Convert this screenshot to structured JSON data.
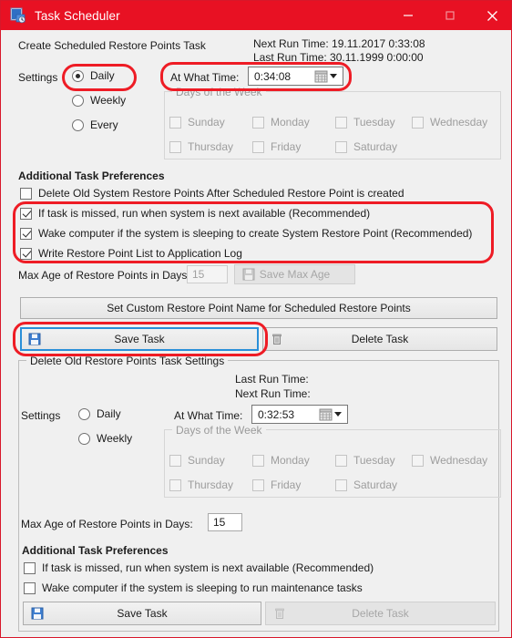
{
  "window": {
    "title": "Task Scheduler",
    "icon": "task-scheduler-icon",
    "minimize": "–",
    "maximize": "□",
    "close": "✕",
    "accent_color": "#e81123",
    "client_bg": "#f0f0f0"
  },
  "top": {
    "heading": "Create Scheduled Restore Points Task",
    "next_run_time": "Next Run Time: 19.11.2017 0:33:08",
    "last_run_time": "Last Run Time: 30.11.1999 0:00:00",
    "settings_label": "Settings",
    "radios": [
      {
        "label": "Daily",
        "checked": true
      },
      {
        "label": "Weekly",
        "checked": false
      },
      {
        "label": "Every",
        "checked": false
      }
    ],
    "time_label": "At What Time:",
    "time_value": "0:34:08",
    "days_group_legend": "Days of the Week",
    "days": [
      {
        "label": "Sunday",
        "checked": false
      },
      {
        "label": "Monday",
        "checked": false
      },
      {
        "label": "Tuesday",
        "checked": false
      },
      {
        "label": "Wednesday",
        "checked": false
      },
      {
        "label": "Thursday",
        "checked": false
      },
      {
        "label": "Friday",
        "checked": false
      },
      {
        "label": "Saturday",
        "checked": false
      }
    ]
  },
  "prefs": {
    "heading": "Additional Task Preferences",
    "items": [
      {
        "label": "Delete Old System Restore Points After Scheduled Restore Point is created",
        "checked": false
      },
      {
        "label": "If task is missed, run when system is next available (Recommended)",
        "checked": true
      },
      {
        "label": "Wake computer if the system is sleeping to create System Restore Point (Recommended)",
        "checked": true
      },
      {
        "label": "Write Restore Point List to Application Log",
        "checked": true
      }
    ],
    "max_age_label": "Max Age of Restore Points in Days:",
    "max_age_value": "15",
    "save_max_age_label": "Save Max Age",
    "custom_name_button": "Set Custom Restore Point Name for Scheduled Restore Points",
    "save_task_label": "Save Task",
    "delete_task_label": "Delete Task"
  },
  "bottom": {
    "group_legend": "Delete Old Restore Points Task Settings",
    "last_run_time": "Last Run Time:",
    "next_run_time": "Next Run Time:",
    "settings_label": "Settings",
    "radios": [
      {
        "label": "Daily",
        "checked": false
      },
      {
        "label": "Weekly",
        "checked": false
      }
    ],
    "time_label": "At What Time:",
    "time_value": "0:32:53",
    "days_group_legend": "Days of the Week",
    "days": [
      {
        "label": "Sunday",
        "checked": false
      },
      {
        "label": "Monday",
        "checked": false
      },
      {
        "label": "Tuesday",
        "checked": false
      },
      {
        "label": "Wednesday",
        "checked": false
      },
      {
        "label": "Thursday",
        "checked": false
      },
      {
        "label": "Friday",
        "checked": false
      },
      {
        "label": "Saturday",
        "checked": false
      }
    ],
    "max_age_label": "Max Age of Restore Points in Days:",
    "max_age_value": "15",
    "prefs_heading": "Additional Task Preferences",
    "prefs": [
      {
        "label": "If task is missed, run when system is next available (Recommended)",
        "checked": false
      },
      {
        "label": "Wake computer if the system is sleeping to run maintenance tasks",
        "checked": false
      }
    ],
    "save_task_label": "Save Task",
    "delete_task_label": "Delete Task"
  },
  "annotations": {
    "color": "#ee1c25",
    "regions": [
      "daily-radio",
      "at-what-time-field",
      "checked-preferences-group",
      "save-task-button"
    ]
  }
}
